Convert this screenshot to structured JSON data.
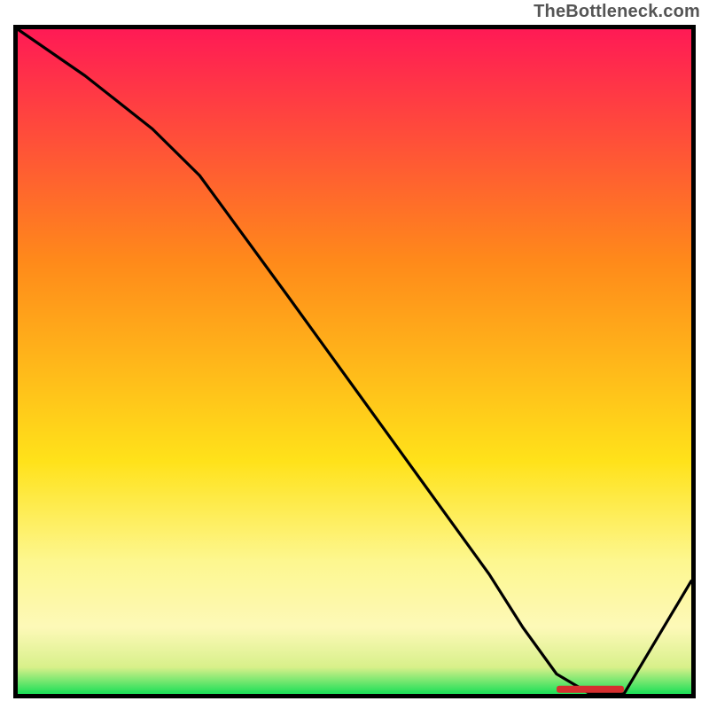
{
  "attribution": "TheBottleneck.com",
  "colors": {
    "gradient_top": "#ff1a55",
    "gradient_mid_warm": "#ff8a1a",
    "gradient_mid_yellow": "#ffe21a",
    "gradient_pale_yellow": "#fdf9b8",
    "gradient_bottom": "#1adf57",
    "frame": "#000000",
    "curve": "#000000",
    "marker": "#d62f2f"
  },
  "chart_data": {
    "type": "line",
    "title": "",
    "xlabel": "",
    "ylabel": "",
    "xlim": [
      0,
      100
    ],
    "ylim": [
      0,
      100
    ],
    "grid": false,
    "legend": false,
    "series": [
      {
        "name": "bottleneck-curve",
        "x": [
          0,
          10,
          20,
          27,
          40,
          50,
          60,
          70,
          75,
          80,
          85,
          90,
          100
        ],
        "y": [
          100,
          93,
          85,
          78,
          60,
          46,
          32,
          18,
          10,
          3,
          0,
          0,
          17
        ]
      }
    ],
    "annotations": [
      {
        "name": "optimum-marker",
        "x_start": 80,
        "x_end": 90,
        "y": 0.7
      }
    ],
    "gradient_stops_pct": [
      {
        "offset": 0,
        "color": "#ff1a55"
      },
      {
        "offset": 35,
        "color": "#ff8a1a"
      },
      {
        "offset": 65,
        "color": "#ffe21a"
      },
      {
        "offset": 80,
        "color": "#fdf78f"
      },
      {
        "offset": 90,
        "color": "#fdf9b8"
      },
      {
        "offset": 96,
        "color": "#d8f08a"
      },
      {
        "offset": 100,
        "color": "#1adf57"
      }
    ]
  }
}
